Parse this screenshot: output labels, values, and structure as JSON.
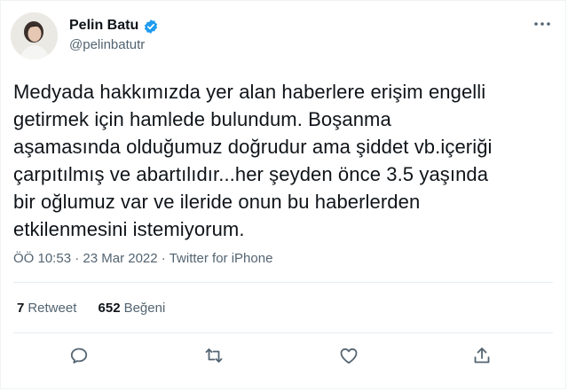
{
  "author": {
    "display_name": "Pelin Batu",
    "handle": "@pelinbatutr",
    "verified_icon": "verified-badge-icon",
    "avatar_icon": "profile-photo"
  },
  "tweet": {
    "text": "Medyada hakkımızda yer alan haberlere erişim engelli\ngetirmek için hamlede bulundum. Boşanma\naşamasında olduğumuz doğrudur ama şiddet vb.içeriği\nçarpıtılmış ve abartılıdır...her şeyden önce 3.5 yaşında\nbir oğlumuz var ve ileride onun bu haberlerden\netkilenmesini istemiyorum."
  },
  "meta": {
    "time": "ÖÖ 10:53",
    "separator": " · ",
    "date": "23 Mar 2022",
    "source": "Twitter for iPhone"
  },
  "stats": {
    "retweets_count": "7",
    "retweets_label": "Retweet",
    "likes_count": "652",
    "likes_label": "Beğeni"
  },
  "actions": [
    "reply-icon",
    "retweet-icon",
    "like-icon",
    "share-icon"
  ],
  "colors": {
    "accent": "#1d9bf0",
    "text": "#0f1419",
    "secondary": "#536471",
    "divider": "#e6ecf0"
  }
}
